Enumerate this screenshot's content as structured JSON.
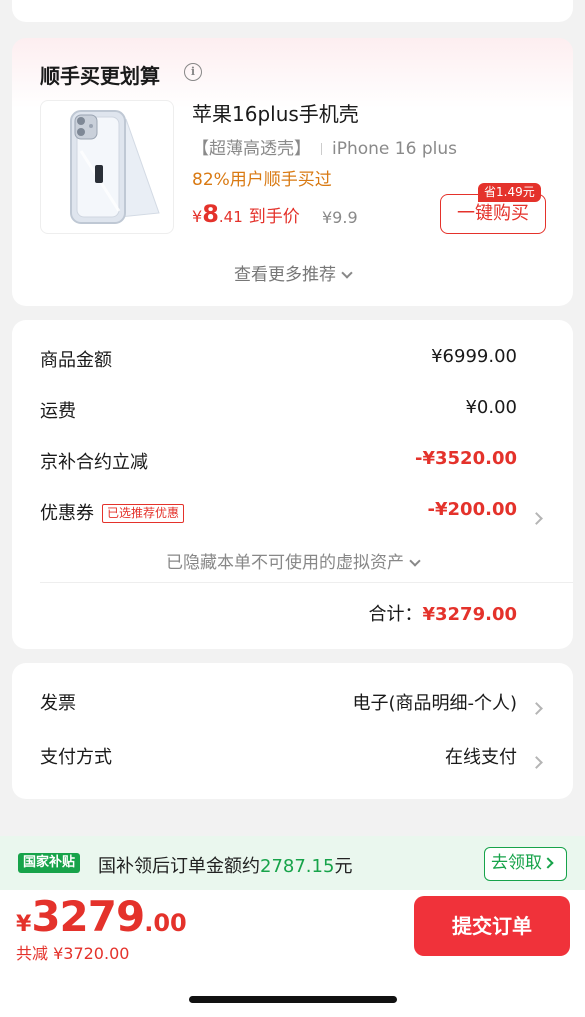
{
  "recommend": {
    "title": "顺手买更划算",
    "info_icon": "i",
    "product": {
      "name": "苹果16plus手机壳",
      "tag": "【超薄高透壳】",
      "model": "iPhone 16 plus",
      "rate": "82%用户顺手买过",
      "price_yen": "¥",
      "price_int": "8",
      "price_dec": ".41",
      "price_label": "到手价",
      "original_price": "¥9.9",
      "save_badge": "省1.49元",
      "buy_label": "一键购买"
    },
    "more_label": "查看更多推荐"
  },
  "summary": {
    "goods_label": "商品金额",
    "goods_value": "¥6999.00",
    "shipping_label": "运费",
    "shipping_value": "¥0.00",
    "subsidy_label": "京补合约立减",
    "subsidy_value": "-¥3520.00",
    "coupon_label": "优惠券",
    "coupon_tag": "已选推荐优惠",
    "coupon_value": "-¥200.00",
    "hidden_assets": "已隐藏本单不可使用的虚拟资产",
    "total_label": "合计：",
    "total_value": "¥3279.00"
  },
  "invoice": {
    "invoice_label": "发票",
    "invoice_value": "电子(商品明细-个人)",
    "payment_label": "支付方式",
    "payment_value": "在线支付"
  },
  "subsidy_bar": {
    "tag": "国家补贴",
    "text_prefix": "国补领后订单金额约",
    "amount": "2787.15",
    "text_suffix": "元",
    "claim_label": "去领取"
  },
  "bottom": {
    "yen": "¥",
    "price_int": "3279",
    "price_dec": ".00",
    "discount": "共减 ¥3720.00",
    "submit_label": "提交订单"
  },
  "colors": {
    "accent_red": "#e4322b",
    "green": "#17a34a",
    "orange": "#d97a13"
  }
}
